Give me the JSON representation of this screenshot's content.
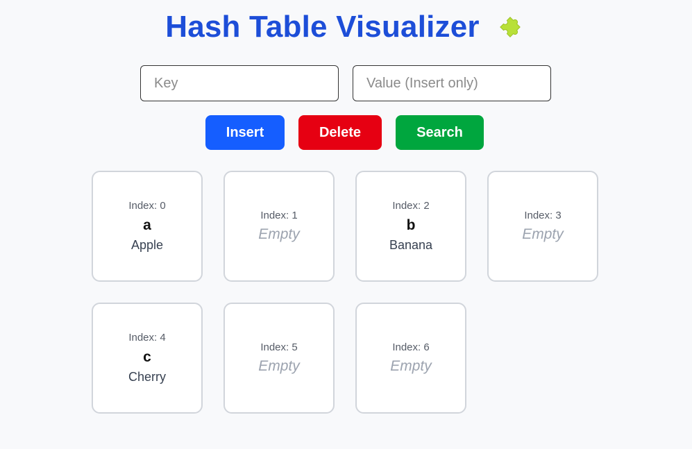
{
  "header": {
    "title": "Hash Table Visualizer",
    "icon": "puzzle-piece-icon",
    "icon_color": "#b8e038"
  },
  "inputs": {
    "key_placeholder": "Key",
    "key_value": "",
    "value_placeholder": "Value (Insert only)",
    "value_value": ""
  },
  "buttons": {
    "insert_label": "Insert",
    "delete_label": "Delete",
    "search_label": "Search"
  },
  "colors": {
    "title": "#1d4ed8",
    "insert": "#155eff",
    "delete": "#e60012",
    "search": "#00a63e"
  },
  "table": {
    "cells": [
      {
        "index_label": "Index: 0",
        "key": "a",
        "value": "Apple"
      },
      {
        "index_label": "Index: 1",
        "empty_label": "Empty"
      },
      {
        "index_label": "Index: 2",
        "key": "b",
        "value": "Banana"
      },
      {
        "index_label": "Index: 3",
        "empty_label": "Empty"
      },
      {
        "index_label": "Index: 4",
        "key": "c",
        "value": "Cherry"
      },
      {
        "index_label": "Index: 5",
        "empty_label": "Empty"
      },
      {
        "index_label": "Index: 6",
        "empty_label": "Empty"
      }
    ]
  }
}
